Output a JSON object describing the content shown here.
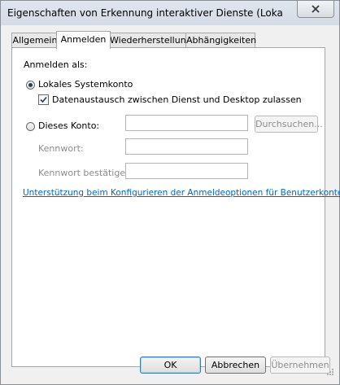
{
  "window": {
    "title": "Eigenschaften von Erkennung interaktiver Dienste (Lokaler Comp..."
  },
  "tabs": [
    {
      "label": "Allgemein",
      "active": false
    },
    {
      "label": "Anmelden",
      "active": true
    },
    {
      "label": "Wiederherstellung",
      "active": false
    },
    {
      "label": "Abhängigkeiten",
      "active": false
    }
  ],
  "logon": {
    "heading": "Anmelden als:",
    "local_system": {
      "label": "Lokales Systemkonto",
      "selected": true
    },
    "desktop_interaction": {
      "label": "Datenaustausch zwischen Dienst und Desktop zulassen",
      "checked": true
    },
    "this_account": {
      "label": "Dieses Konto:",
      "selected": false,
      "value": ""
    },
    "browse_label": "Durchsuchen...",
    "password": {
      "label": "Kennwort:",
      "value": ""
    },
    "confirm_password": {
      "label": "Kennwort bestätigen:",
      "value": ""
    },
    "help_link": "Unterstützung beim Konfigurieren der Anmeldeoptionen für Benutzerkonten"
  },
  "buttons": {
    "ok": "OK",
    "cancel": "Abbrechen",
    "apply": "Übernehmen"
  },
  "colors": {
    "link": "#0066cc",
    "disabled_text": "#8d8d8d"
  }
}
